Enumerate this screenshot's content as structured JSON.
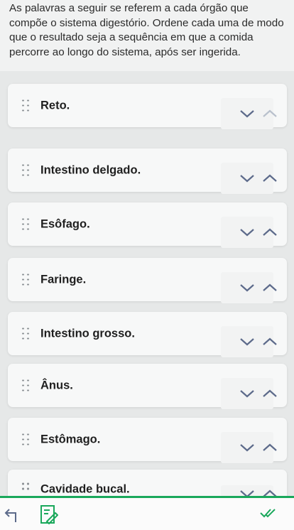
{
  "question": {
    "text": "As palavras a seguir se referem a cada órgão que compõe o sistema digestório. Ordene cada uma de modo que o resultado seja a sequência em que a comida percorre ao longo do sistema, após ser ingerida."
  },
  "items": [
    {
      "label": "Reto."
    },
    {
      "label": "Intestino delgado."
    },
    {
      "label": "Esôfago."
    },
    {
      "label": "Faringe."
    },
    {
      "label": "Intestino grosso."
    },
    {
      "label": "Ânus."
    },
    {
      "label": "Estômago."
    },
    {
      "label": "Cavidade bucal."
    }
  ],
  "icons": {
    "drag": "drag-handle-icon",
    "down": "chevron-down-icon",
    "up": "chevron-up-icon",
    "back": "back-arrow-icon",
    "edit": "edit-icon",
    "check": "double-check-icon"
  },
  "colors": {
    "accent": "#1aa85b",
    "card": "#f7f8f8",
    "background": "#e6e8e8"
  }
}
